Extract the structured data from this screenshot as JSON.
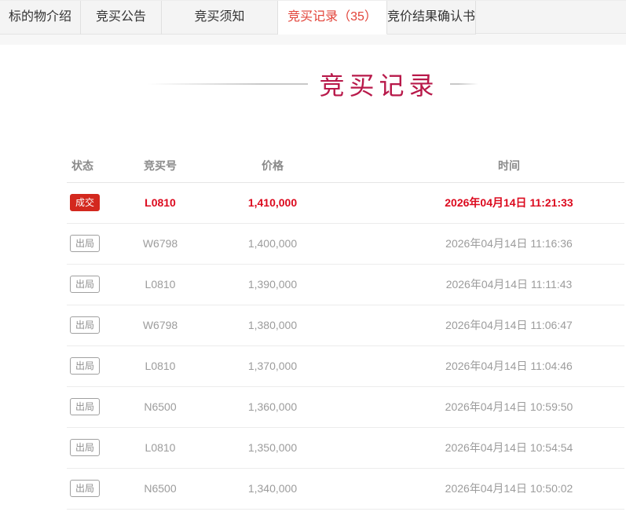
{
  "tabs": [
    {
      "label": "标的物介绍",
      "active": false
    },
    {
      "label": "竞买公告",
      "active": false
    },
    {
      "label": "竞买须知",
      "active": false
    },
    {
      "label": "竞买记录（35）",
      "active": true
    },
    {
      "label": "竞价结果确认书",
      "active": false
    }
  ],
  "title": "竞买记录",
  "table": {
    "headers": {
      "status": "状态",
      "bidder": "竞买号",
      "price": "价格",
      "time": "时间"
    },
    "rows": [
      {
        "status": "成交",
        "bidder": "L0810",
        "price": "1,410,000",
        "time": "2026年04月14日 11:21:33",
        "winner": true
      },
      {
        "status": "出局",
        "bidder": "W6798",
        "price": "1,400,000",
        "time": "2026年04月14日 11:16:36",
        "winner": false
      },
      {
        "status": "出局",
        "bidder": "L0810",
        "price": "1,390,000",
        "time": "2026年04月14日 11:11:43",
        "winner": false
      },
      {
        "status": "出局",
        "bidder": "W6798",
        "price": "1,380,000",
        "time": "2026年04月14日 11:06:47",
        "winner": false
      },
      {
        "status": "出局",
        "bidder": "L0810",
        "price": "1,370,000",
        "time": "2026年04月14日 11:04:46",
        "winner": false
      },
      {
        "status": "出局",
        "bidder": "N6500",
        "price": "1,360,000",
        "time": "2026年04月14日 10:59:50",
        "winner": false
      },
      {
        "status": "出局",
        "bidder": "L0810",
        "price": "1,350,000",
        "time": "2026年04月14日 10:54:54",
        "winner": false
      },
      {
        "status": "出局",
        "bidder": "N6500",
        "price": "1,340,000",
        "time": "2026年04月14日 10:50:02",
        "winner": false
      }
    ]
  },
  "colors": {
    "tab_active_red": "#e24339",
    "title_red": "#b8194a",
    "winner_red": "#dc0a1e",
    "badge_deal_bg": "#d3281e",
    "body_gray": "#9c9c9c"
  }
}
